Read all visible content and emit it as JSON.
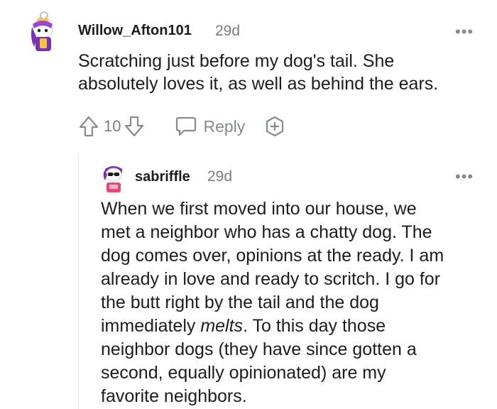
{
  "comment": {
    "username": "Willow_Afton101",
    "age": "29d",
    "text_lines": [
      "Scratching just before my dog's tail. She",
      "absolutely loves it, as well as behind the ears."
    ],
    "vote_count": "10",
    "reply_label": "Reply",
    "more_label": "•••"
  },
  "reply": {
    "username": "sabriffle",
    "age": "29d",
    "more_label": "•••",
    "text_lines": [
      "When we first moved into our house, we",
      "met a neighbor who has a chatty dog. The",
      "dog comes over, opinions at the ready. I am",
      "already in love and ready to scritch. I go for",
      "the butt right by the tail and the dog",
      "immediately ",
      "melts",
      ". To this day those",
      "neighbor dogs (they have since gotten a",
      "second, equally opinionated) are my",
      "favorite neighbors."
    ]
  },
  "colors": {
    "text": "#1c1c1c",
    "meta": "#7c7c7c",
    "icon": "#878a8c",
    "avatar1_accent": "#7b2fb5",
    "avatar2_accent": "#e8457a"
  },
  "icons": [
    "upvote-icon",
    "downvote-icon",
    "reply-bubble-icon",
    "award-icon",
    "more-options-icon"
  ]
}
